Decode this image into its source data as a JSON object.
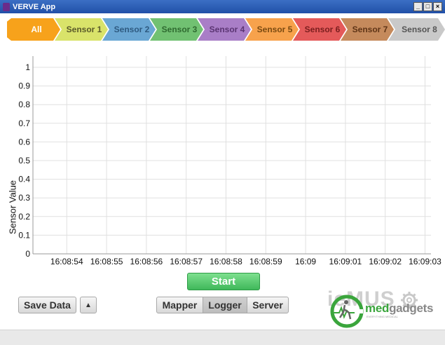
{
  "window": {
    "title": "VERVE App",
    "buttons": [
      "_",
      "□",
      "×"
    ]
  },
  "tabs": [
    {
      "label": "All",
      "color": "#f7a21b",
      "text_color": "#ffffff"
    },
    {
      "label": "Sensor 1",
      "color": "#d9e36a",
      "text_color": "#5a5a2a"
    },
    {
      "label": "Sensor 2",
      "color": "#6aa7d4",
      "text_color": "#2e5a80"
    },
    {
      "label": "Sensor 3",
      "color": "#71c172",
      "text_color": "#2f6a30"
    },
    {
      "label": "Sensor 4",
      "color": "#a97ec7",
      "text_color": "#5a3472"
    },
    {
      "label": "Sensor 5",
      "color": "#f7a24c",
      "text_color": "#7a4a10"
    },
    {
      "label": "Sensor 6",
      "color": "#e45a5a",
      "text_color": "#7a1e1e"
    },
    {
      "label": "Sensor 7",
      "color": "#c58a5c",
      "text_color": "#5e3416"
    },
    {
      "label": "Sensor 8",
      "color": "#c9c9c9",
      "text_color": "#555555"
    }
  ],
  "chart_data": {
    "type": "line",
    "ylabel": "Sensor Value",
    "xlabel": "",
    "ylim": [
      0,
      1
    ],
    "yticks": [
      "0",
      "0.1",
      "0.2",
      "0.3",
      "0.4",
      "0.5",
      "0.6",
      "0.7",
      "0.8",
      "0.9",
      "1"
    ],
    "xticks": [
      "16:08:54",
      "16:08:55",
      "16:08:56",
      "16:08:57",
      "16:08:58",
      "16:08:59",
      "16:09",
      "16:09:01",
      "16:09:02",
      "16:09:03"
    ],
    "series": [],
    "grid": true
  },
  "controls": {
    "start_label": "Start",
    "save_label": "Save Data",
    "save_menu_icon": "▲",
    "segments": [
      "Mapper",
      "Logger",
      "Server"
    ],
    "selected_segment": "Logger"
  },
  "branding": {
    "faint_text": "ieMUS",
    "brand_med": "med",
    "brand_rest": "gadgets",
    "tagline": "EVERYTHING MEDICAL"
  }
}
